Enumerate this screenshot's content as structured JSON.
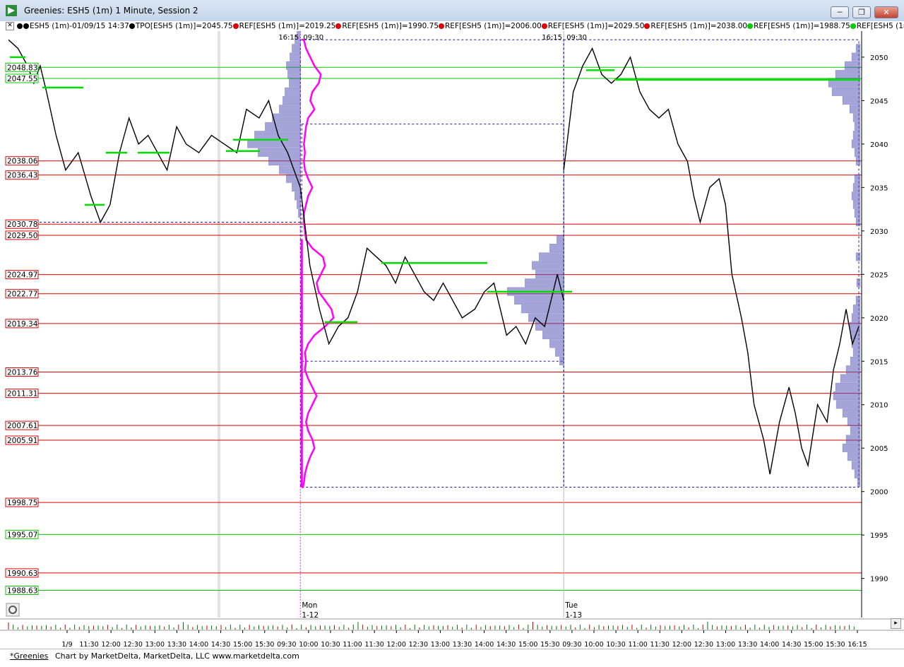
{
  "window": {
    "title": "Greenies: ESH5 (1m) 1 Minute, Session 2",
    "minimize_label": "─",
    "maximize_label": "❐",
    "close_label": "✕"
  },
  "legend": {
    "close_box": "✕",
    "entries": [
      {
        "text": "ESH5 (1m)-01/09/15 14:37",
        "color": "#000000",
        "dots": 2
      },
      {
        "text": "TPO[ESH5 (1m)]=2045.75",
        "color": "#000000",
        "dots": 1
      },
      {
        "text": "REF[ESH5 (1m)]=2019.25",
        "color": "#dd0000",
        "dots": 1
      },
      {
        "text": "REF[ESH5 (1m)]=1990.75",
        "color": "#dd0000",
        "dots": 1
      },
      {
        "text": "REF[ESH5 (1m)]=2006.00",
        "color": "#dd0000",
        "dots": 1
      },
      {
        "text": "REF[ESH5 (1m)]=2029.50",
        "color": "#dd0000",
        "dots": 1
      },
      {
        "text": "REF[ESH5 (1m)]=2038.00",
        "color": "#dd0000",
        "dots": 1
      },
      {
        "text": "REF[ESH5 (1m)]=1988.75",
        "color": "#00cc00",
        "dots": 1
      },
      {
        "text": "REF[ESH5 (1m)]=1995",
        "color": "#00cc00",
        "dots": 1
      }
    ]
  },
  "chart_data": {
    "type": "line",
    "instrument": "ESH5 (1m)",
    "ylim": [
      1985.5,
      2053
    ],
    "y_ticks": [
      2050,
      2045,
      2040,
      2035,
      2030,
      2025,
      2020,
      2015,
      2010,
      2005,
      2000,
      1995,
      1990
    ],
    "ref_levels": [
      {
        "value": 2048.83,
        "label": "2048.83",
        "color": "#00cc00"
      },
      {
        "value": 2047.55,
        "label": "2047.55",
        "color": "#00cc00"
      },
      {
        "value": 2038.06,
        "label": "2038.06",
        "color": "#dd0000"
      },
      {
        "value": 2036.43,
        "label": "2036.43",
        "color": "#dd0000"
      },
      {
        "value": 2030.78,
        "label": "2030.78",
        "color": "#dd0000"
      },
      {
        "value": 2029.5,
        "label": "2029.50",
        "color": "#dd0000"
      },
      {
        "value": 2024.97,
        "label": "2024.97",
        "color": "#dd0000"
      },
      {
        "value": 2022.77,
        "label": "2022.77",
        "color": "#dd0000"
      },
      {
        "value": 2019.34,
        "label": "2019.34",
        "color": "#dd0000"
      },
      {
        "value": 2013.76,
        "label": "2013.76",
        "color": "#dd0000"
      },
      {
        "value": 2011.31,
        "label": "2011.31",
        "color": "#dd0000"
      },
      {
        "value": 2007.61,
        "label": "2007.61",
        "color": "#dd0000"
      },
      {
        "value": 2005.91,
        "label": "2005.91",
        "color": "#dd0000"
      },
      {
        "value": 1998.75,
        "label": "1998.75",
        "color": "#dd0000"
      },
      {
        "value": 1995.07,
        "label": "1995.07",
        "color": "#00cc00"
      },
      {
        "value": 1990.63,
        "label": "1990.63",
        "color": "#dd0000"
      },
      {
        "value": 1988.63,
        "label": "1988.63",
        "color": "#00cc00"
      }
    ],
    "x_ticks": [
      "1/9",
      "11:30",
      "12:00",
      "12:30",
      "13:00",
      "13:30",
      "14:00",
      "14:30",
      "15:00",
      "15:30",
      "09:30",
      "10:00",
      "10:30",
      "11:00",
      "11:30",
      "12:00",
      "12:30",
      "13:00",
      "13:30",
      "14:00",
      "14:30",
      "15:00",
      "15:30",
      "09:30",
      "10:00",
      "10:30",
      "11:00",
      "11:30",
      "12:00",
      "12:30",
      "13:00",
      "13:30",
      "14:00",
      "14:30",
      "15:00",
      "15:30",
      "16:15"
    ],
    "session_markers": [
      {
        "top_label": "16:15",
        "top_label2": "09:30",
        "day_label": "Mon",
        "date_label": "1-12"
      },
      {
        "top_label": "16:15",
        "top_label2": "09:30",
        "day_label": "Tue",
        "date_label": "1-13"
      }
    ],
    "segments": [
      {
        "session": "1/9",
        "points": [
          [
            0,
            2052
          ],
          [
            3,
            2051
          ],
          [
            6,
            2049
          ],
          [
            8,
            2047
          ],
          [
            10,
            2049
          ],
          [
            12,
            2046
          ],
          [
            15,
            2041
          ],
          [
            18,
            2037
          ],
          [
            22,
            2039
          ],
          [
            26,
            2034
          ],
          [
            29,
            2031
          ],
          [
            32,
            2033
          ],
          [
            35,
            2039
          ],
          [
            38,
            2043
          ],
          [
            41,
            2040
          ],
          [
            44,
            2041
          ],
          [
            47,
            2039
          ],
          [
            50,
            2037
          ],
          [
            53,
            2042
          ],
          [
            56,
            2040
          ],
          [
            60,
            2039
          ],
          [
            64,
            2041
          ],
          [
            68,
            2040
          ],
          [
            72,
            2039
          ],
          [
            75,
            2044
          ],
          [
            79,
            2043
          ],
          [
            82,
            2045
          ],
          [
            85,
            2041
          ],
          [
            88,
            2039
          ],
          [
            90,
            2037
          ],
          [
            92,
            2035
          ]
        ]
      },
      {
        "session": "1-12",
        "points": [
          [
            92,
            2035
          ],
          [
            95,
            2026
          ],
          [
            98,
            2021
          ],
          [
            101,
            2017
          ],
          [
            104,
            2019
          ],
          [
            107,
            2020
          ],
          [
            110,
            2023
          ],
          [
            113,
            2028
          ],
          [
            116,
            2027
          ],
          [
            119,
            2026
          ],
          [
            122,
            2024
          ],
          [
            125,
            2027
          ],
          [
            128,
            2025
          ],
          [
            131,
            2023
          ],
          [
            134,
            2022
          ],
          [
            137,
            2024
          ],
          [
            140,
            2022
          ],
          [
            143,
            2020
          ],
          [
            147,
            2021
          ],
          [
            150,
            2023
          ],
          [
            153,
            2024
          ],
          [
            157,
            2018
          ],
          [
            160,
            2019
          ],
          [
            163,
            2017
          ],
          [
            166,
            2020
          ],
          [
            169,
            2019
          ],
          [
            171,
            2022
          ],
          [
            173,
            2025
          ],
          [
            175,
            2022
          ]
        ]
      },
      {
        "session": "1-13",
        "points": [
          [
            175,
            2037
          ],
          [
            178,
            2046
          ],
          [
            181,
            2049
          ],
          [
            184,
            2051
          ],
          [
            187,
            2048
          ],
          [
            190,
            2047
          ],
          [
            193,
            2048
          ],
          [
            196,
            2050
          ],
          [
            199,
            2046
          ],
          [
            202,
            2044
          ],
          [
            205,
            2043
          ],
          [
            208,
            2044
          ],
          [
            211,
            2040
          ],
          [
            214,
            2038
          ],
          [
            216,
            2034
          ],
          [
            218,
            2031
          ],
          [
            221,
            2035
          ],
          [
            224,
            2036
          ],
          [
            226,
            2033
          ],
          [
            228,
            2025
          ],
          [
            231,
            2020
          ],
          [
            233,
            2016
          ],
          [
            235,
            2010
          ],
          [
            238,
            2006
          ],
          [
            240,
            2002
          ],
          [
            243,
            2008
          ],
          [
            246,
            2012
          ],
          [
            248,
            2009
          ],
          [
            250,
            2005
          ],
          [
            252,
            2003
          ],
          [
            255,
            2010
          ],
          [
            258,
            2008
          ],
          [
            260,
            2014
          ],
          [
            262,
            2017
          ],
          [
            264,
            2021
          ],
          [
            266,
            2017
          ],
          [
            268,
            2019
          ]
        ]
      }
    ],
    "volume_profiles": [
      {
        "levels": [
          [
            2053,
            5
          ],
          [
            2052,
            8
          ],
          [
            2051,
            12
          ],
          [
            2050,
            15
          ],
          [
            2049,
            20
          ],
          [
            2048,
            18
          ],
          [
            2047,
            16
          ],
          [
            2046,
            22
          ],
          [
            2045,
            25
          ],
          [
            2044,
            30
          ],
          [
            2043,
            40
          ],
          [
            2042,
            50
          ],
          [
            2041,
            65
          ],
          [
            2040,
            75
          ],
          [
            2039,
            60
          ],
          [
            2038,
            45
          ],
          [
            2037,
            30
          ],
          [
            2036,
            20
          ],
          [
            2035,
            12
          ],
          [
            2034,
            8
          ],
          [
            2033,
            5
          ],
          [
            2032,
            3
          ]
        ]
      },
      {
        "levels": [
          [
            2029,
            10
          ],
          [
            2028,
            20
          ],
          [
            2027,
            35
          ],
          [
            2026,
            45
          ],
          [
            2025,
            40
          ],
          [
            2024,
            55
          ],
          [
            2023,
            80
          ],
          [
            2022,
            70
          ],
          [
            2021,
            60
          ],
          [
            2020,
            50
          ],
          [
            2019,
            40
          ],
          [
            2018,
            30
          ],
          [
            2017,
            20
          ],
          [
            2016,
            12
          ],
          [
            2015,
            6
          ]
        ]
      },
      {
        "levels": [
          [
            2051,
            6
          ],
          [
            2050,
            12
          ],
          [
            2049,
            22
          ],
          [
            2048,
            35
          ],
          [
            2047,
            45
          ],
          [
            2046,
            40
          ],
          [
            2045,
            25
          ],
          [
            2044,
            15
          ],
          [
            2043,
            10
          ],
          [
            2042,
            8
          ],
          [
            2041,
            10
          ],
          [
            2040,
            12
          ],
          [
            2039,
            8
          ],
          [
            2038,
            6
          ],
          [
            2036,
            8
          ],
          [
            2035,
            10
          ],
          [
            2034,
            12
          ],
          [
            2033,
            10
          ],
          [
            2032,
            8
          ],
          [
            2031,
            6
          ],
          [
            2027,
            6
          ],
          [
            2024,
            5
          ],
          [
            2022,
            6
          ],
          [
            2021,
            10
          ],
          [
            2020,
            12
          ],
          [
            2019,
            15
          ],
          [
            2018,
            14
          ],
          [
            2017,
            12
          ],
          [
            2016,
            10
          ],
          [
            2015,
            14
          ],
          [
            2014,
            20
          ],
          [
            2013,
            28
          ],
          [
            2012,
            35
          ],
          [
            2011,
            38
          ],
          [
            2010,
            34
          ],
          [
            2009,
            25
          ],
          [
            2008,
            18
          ],
          [
            2007,
            14
          ],
          [
            2006,
            20
          ],
          [
            2005,
            25
          ],
          [
            2004,
            18
          ],
          [
            2003,
            12
          ],
          [
            2002,
            8
          ],
          [
            2001,
            4
          ]
        ]
      }
    ],
    "tpo_profile": [
      [
        2052,
        2
      ],
      [
        2051,
        4
      ],
      [
        2050,
        8
      ],
      [
        2049,
        12
      ],
      [
        2048,
        18
      ],
      [
        2047,
        16
      ],
      [
        2046,
        10
      ],
      [
        2045,
        8
      ],
      [
        2044,
        12
      ],
      [
        2043,
        6
      ],
      [
        2042,
        4
      ],
      [
        2041,
        3
      ],
      [
        2040,
        2
      ],
      [
        2039,
        3
      ],
      [
        2038,
        2
      ],
      [
        2037,
        3
      ],
      [
        2036,
        6
      ],
      [
        2035,
        10
      ],
      [
        2034,
        6
      ],
      [
        2033,
        4
      ],
      [
        2032,
        2
      ],
      [
        2031,
        2
      ],
      [
        2029,
        4
      ],
      [
        2028,
        10
      ],
      [
        2027,
        20
      ],
      [
        2026,
        22
      ],
      [
        2025,
        18
      ],
      [
        2024,
        14
      ],
      [
        2023,
        16
      ],
      [
        2022,
        22
      ],
      [
        2021,
        28
      ],
      [
        2020,
        30
      ],
      [
        2019,
        22
      ],
      [
        2018,
        12
      ],
      [
        2017,
        6
      ],
      [
        2016,
        3
      ],
      [
        2015,
        4
      ],
      [
        2014,
        3
      ],
      [
        2013,
        6
      ],
      [
        2012,
        10
      ],
      [
        2011,
        14
      ],
      [
        2010,
        10
      ],
      [
        2009,
        6
      ],
      [
        2008,
        4
      ],
      [
        2007,
        6
      ],
      [
        2006,
        10
      ],
      [
        2005,
        12
      ],
      [
        2004,
        8
      ],
      [
        2003,
        5
      ],
      [
        2002,
        3
      ],
      [
        2001,
        2
      ],
      [
        2000.5,
        1
      ]
    ]
  },
  "footer": {
    "tab_label": "*Greenies",
    "credit": "Chart by MarketDelta, MarketDelta, LLC www.marketdelta.com"
  }
}
